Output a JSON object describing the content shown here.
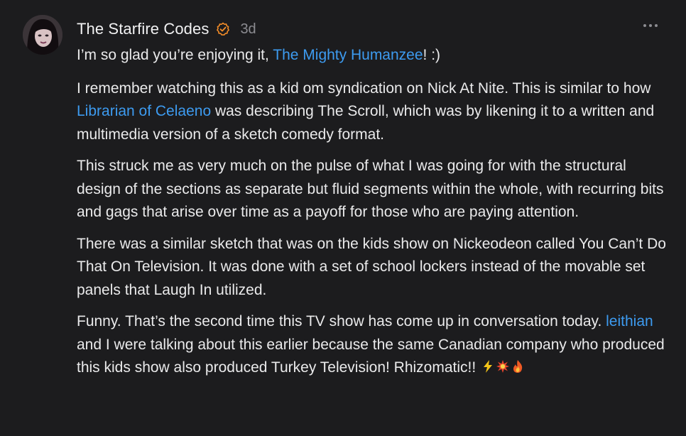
{
  "comment": {
    "author": "The Starfire Codes",
    "timestamp": "3d",
    "icons": {
      "verified": "verified-badge-icon",
      "more": "more-options-icon",
      "emojis": [
        "lightning-icon",
        "explosion-icon",
        "fire-icon"
      ]
    },
    "colors": {
      "background": "#1c1c1e",
      "text": "#eaeaeb",
      "mention": "#3d9bf0",
      "muted": "#8c8c91",
      "badge": "#f28c28"
    },
    "paragraphs": {
      "p1": {
        "a": "I’m so glad you’re enjoying it, ",
        "mention": "The Mighty Humanzee",
        "b": "! :)"
      },
      "p2": {
        "a": "I remember watching this as a kid om syndication on Nick At Nite. This is similar to how ",
        "mention": "Librarian of Celaeno",
        "b": " was describing The Scroll, which was by likening it to a written and multimedia version of a sketch comedy format."
      },
      "p3": "This struck me as very much on the pulse of what I was going for with the structural design of the sections as separate but fluid segments within the whole, with recurring bits and gags that arise over time as a payoff for those who are paying attention.",
      "p4": "There was a similar sketch that was on the kids show on Nickeodeon called You Can’t Do That On Television. It was done with a set of school lockers instead of the movable set panels that Laugh In utilized.",
      "p5": {
        "a": "Funny. That’s the second time this TV show has come up in conversation today. ",
        "mention": "leithian",
        "b": " and I were talking about this earlier because the same Canadian company who produced this kids show also produced Turkey Television! Rhizomatic!! "
      }
    }
  }
}
